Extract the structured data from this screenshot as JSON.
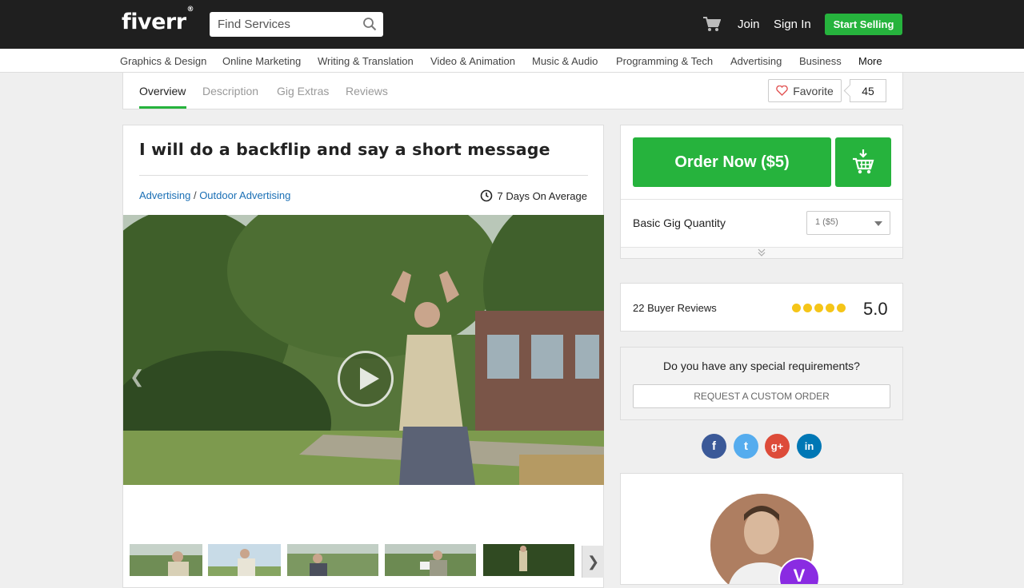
{
  "header": {
    "logo": "fiverr",
    "logo_mark": "®",
    "search_placeholder": "Find Services",
    "join_label": "Join",
    "signin_label": "Sign In",
    "start_selling_label": "Start Selling"
  },
  "categories": [
    "Graphics & Design",
    "Online Marketing",
    "Writing & Translation",
    "Video & Animation",
    "Music & Audio",
    "Programming & Tech",
    "Advertising",
    "Business",
    "More"
  ],
  "tabs": {
    "items": [
      "Overview",
      "Description",
      "Gig Extras",
      "Reviews"
    ],
    "active": "Overview",
    "favorite_label": "Favorite",
    "favorite_count": "45"
  },
  "gig": {
    "title": "I will do a backflip and say a short message",
    "category": "Advertising",
    "separator": "/",
    "subcategory": "Outdoor Advertising",
    "delivery": "7 Days On Average"
  },
  "order": {
    "button_label": "Order Now ($5)",
    "quantity_label": "Basic Gig Quantity",
    "quantity_value": "1 ($5)"
  },
  "reviews": {
    "count_label": "22 Buyer Reviews",
    "rating": "5.0",
    "stars": 5
  },
  "custom": {
    "question": "Do you have any special requirements?",
    "button_label": "REQUEST A CUSTOM ORDER"
  },
  "social": [
    {
      "icon": "facebook-icon",
      "glyph": "f",
      "color": "#3b5998"
    },
    {
      "icon": "twitter-icon",
      "glyph": "t",
      "color": "#55acee"
    },
    {
      "icon": "google-plus-icon",
      "glyph": "g+",
      "color": "#dd4b39"
    },
    {
      "icon": "linkedin-icon",
      "glyph": "in",
      "color": "#0077b5"
    }
  ],
  "seller": {
    "badge": "V"
  },
  "colors": {
    "brand_green": "#26b33d",
    "topbar": "#1f1f1f",
    "link_blue": "#1a6fb5",
    "star_yellow": "#f5c518"
  }
}
